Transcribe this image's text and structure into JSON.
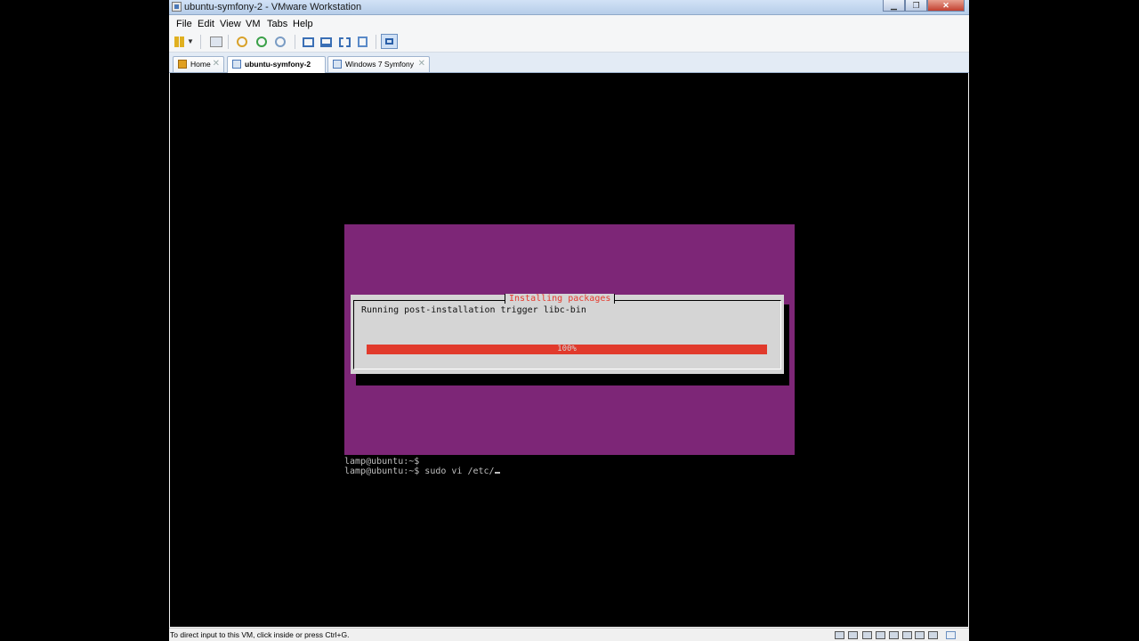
{
  "window": {
    "title": "ubuntu-symfony-2 - VMware Workstation",
    "minimize_label": "▁",
    "maximize_label": "❐",
    "close_label": "✕"
  },
  "menu": {
    "items": [
      "File",
      "Edit",
      "View",
      "VM",
      "Tabs",
      "Help"
    ]
  },
  "tabs": [
    {
      "label": "Home",
      "icon": "home-icon",
      "active": false
    },
    {
      "label": "ubuntu-symfony-2",
      "icon": "vm-icon",
      "active": true
    },
    {
      "label": "Windows 7 Symfony",
      "icon": "vm-icon",
      "active": false
    }
  ],
  "vm": {
    "dialog_title": "Installing packages",
    "dialog_message": "Running post-installation trigger libc-bin",
    "progress_text": "100%",
    "progress_fraction": 1.0,
    "terminal_lines": [
      "lamp@ubuntu:~$",
      "lamp@ubuntu:~$ sudo vi /etc/"
    ]
  },
  "status": {
    "text": "To direct input to this VM, click inside or press Ctrl+G."
  },
  "colors": {
    "console_purple": "#7d2677",
    "progress_red": "#e13a2c",
    "dialog_title_red": "#e53b2e"
  }
}
